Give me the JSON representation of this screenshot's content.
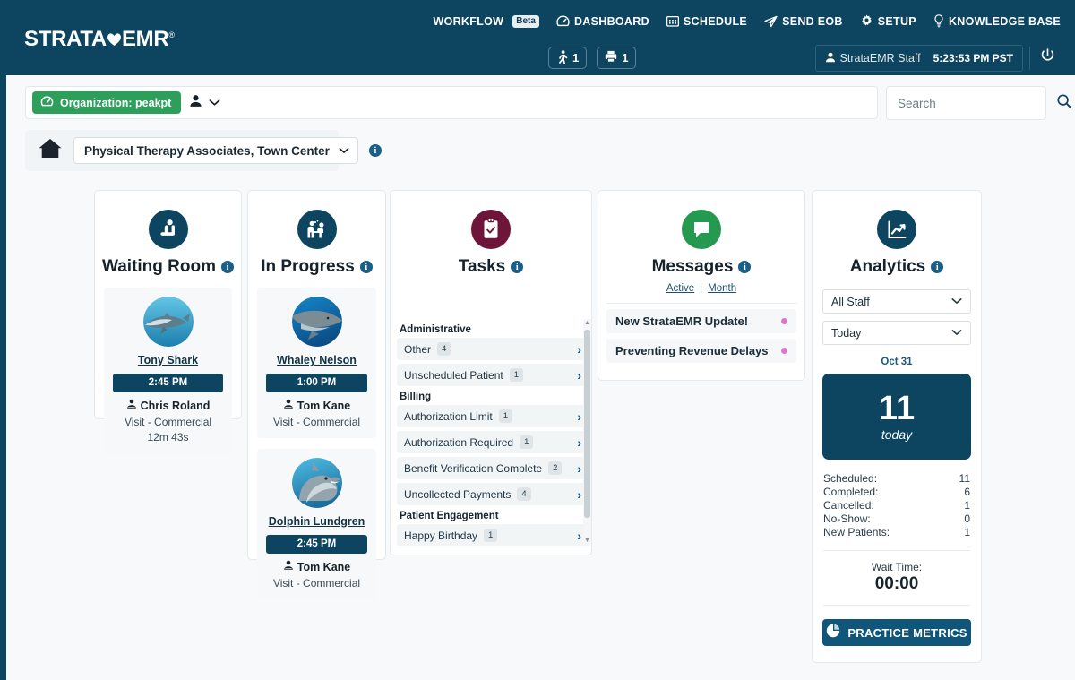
{
  "header": {
    "logo_text_a": "STRATA",
    "logo_text_b": "EMR",
    "logo_tm": "®",
    "nav": [
      {
        "label": "WORKFLOW",
        "icon": "none",
        "badge": "Beta"
      },
      {
        "label": "DASHBOARD",
        "icon": "speedometer-icon"
      },
      {
        "label": "SCHEDULE",
        "icon": "calendar-grid-icon"
      },
      {
        "label": "SEND EOB",
        "icon": "paper-plane-icon"
      },
      {
        "label": "SETUP",
        "icon": "gear-icon"
      },
      {
        "label": "KNOWLEDGE BASE",
        "icon": "lightbulb-icon"
      }
    ],
    "counters": [
      {
        "icon": "patient-walking-icon",
        "count": "1"
      },
      {
        "icon": "printer-icon",
        "count": "1"
      }
    ],
    "user_name": "StrataEMR Staff",
    "time": "5:23:53 PM PST",
    "power_icon": "power-icon"
  },
  "orgbar": {
    "chip_label": "Organization: peakpt",
    "chip_icon": "speedometer-icon",
    "chip_color": "#2e9e5b",
    "person_icon": "person-icon",
    "chevron_icon": "chevron-down-icon"
  },
  "search": {
    "placeholder": "Search",
    "value": "",
    "icon": "search-icon"
  },
  "location": {
    "home_icon": "home-icon",
    "label": "Physical Therapy Associates, Town Center",
    "caret": "chevron-down-icon",
    "info_icon": "info-icon"
  },
  "cards": {
    "waiting_room": {
      "title": "Waiting Room",
      "icon": "seated-person-icon",
      "icon_color": "#0d4560",
      "patients": [
        {
          "name": "Tony Shark",
          "avatar": "shark-avatar",
          "time": "2:45 PM",
          "provider": "Chris Roland",
          "visit": "Visit - Commercial",
          "duration": "12m 43s"
        }
      ]
    },
    "in_progress": {
      "title": "In Progress",
      "icon": "therapist-patient-icon",
      "icon_color": "#0d4560",
      "patients": [
        {
          "name": "Whaley Nelson",
          "avatar": "whale-avatar",
          "time": "1:00 PM",
          "provider": "Tom Kane",
          "visit": "Visit - Commercial",
          "duration": ""
        },
        {
          "name": "Dolphin Lundgren",
          "avatar": "dolphin-avatar",
          "time": "2:45 PM",
          "provider": "Tom Kane",
          "visit": "Visit - Commercial",
          "duration": ""
        }
      ]
    },
    "tasks": {
      "title": "Tasks",
      "icon": "clipboard-check-icon",
      "icon_color": "#6e1639",
      "groups": [
        {
          "name": "Administrative",
          "rows": [
            {
              "label": "Other",
              "count": "4"
            },
            {
              "label": "Unscheduled Patient",
              "count": "1"
            }
          ]
        },
        {
          "name": "Billing",
          "rows": [
            {
              "label": "Authorization Limit",
              "count": "1"
            },
            {
              "label": "Authorization Required",
              "count": "1"
            },
            {
              "label": "Benefit Verification Complete",
              "count": "2"
            },
            {
              "label": "Uncollected Payments",
              "count": "4"
            }
          ]
        },
        {
          "name": "Patient Engagement",
          "rows": [
            {
              "label": "Happy Birthday",
              "count": "1"
            }
          ]
        }
      ]
    },
    "messages": {
      "title": "Messages",
      "icon": "speech-bubble-icon",
      "icon_color": "#24994f",
      "tabs": [
        {
          "label": "Active",
          "active": true
        },
        {
          "label": "Month",
          "active": false
        }
      ],
      "tab_separator": "|",
      "items": [
        {
          "text": "New StrataEMR Update!",
          "dot_color": "#d977c8"
        },
        {
          "text": "Preventing Revenue Delays",
          "dot_color": "#d977c8"
        }
      ]
    },
    "analytics": {
      "title": "Analytics",
      "icon": "line-chart-icon",
      "icon_color": "#0d4560",
      "staff_select": "All Staff",
      "period_select": "Today",
      "date": "Oct 31",
      "tile_number": "11",
      "tile_label": "today",
      "stats": [
        {
          "label": "Scheduled:",
          "value": "11"
        },
        {
          "label": "Completed:",
          "value": "6"
        },
        {
          "label": "Cancelled:",
          "value": "1"
        },
        {
          "label": "No-Show:",
          "value": "0"
        },
        {
          "label": "New Patients:",
          "value": "1"
        }
      ],
      "wait_label": "Wait Time:",
      "wait_value": "00:00",
      "button_label": "PRACTICE METRICS",
      "button_icon": "pie-chart-icon"
    }
  }
}
